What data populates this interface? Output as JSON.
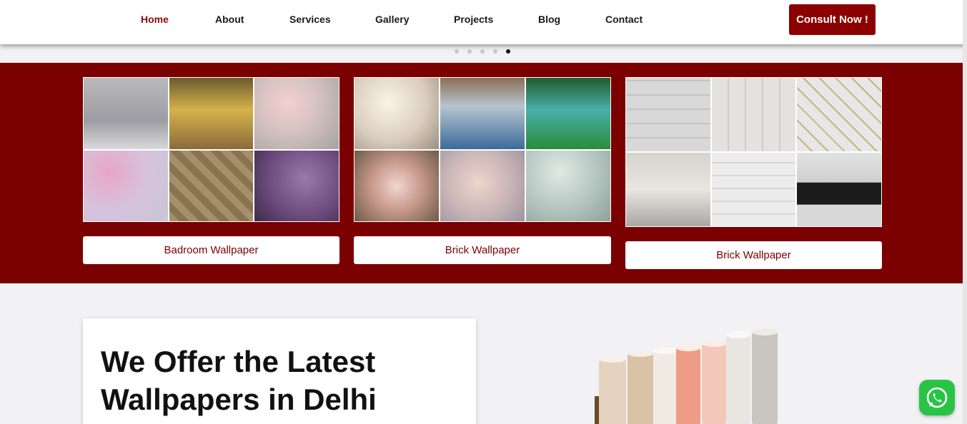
{
  "nav": {
    "items": [
      {
        "label": "Home",
        "active": true
      },
      {
        "label": "About"
      },
      {
        "label": "Services"
      },
      {
        "label": "Gallery"
      },
      {
        "label": "Projects"
      },
      {
        "label": "Blog"
      },
      {
        "label": "Contact"
      }
    ],
    "cta_label": "Consult Now !"
  },
  "slider": {
    "dot_count": 5,
    "active_index": 4
  },
  "categories": [
    {
      "label": "Badroom Wallpaper"
    },
    {
      "label": "Brick Wallpaper"
    },
    {
      "label": "Brick Wallpaper"
    }
  ],
  "offer": {
    "heading": "We Offer the Latest Wallpapers in Delhi"
  },
  "colors": {
    "brand": "#7b0000",
    "nav_active": "#8b0a0a",
    "whatsapp": "#29c445"
  },
  "icons": {
    "chat": "whatsapp-icon"
  }
}
